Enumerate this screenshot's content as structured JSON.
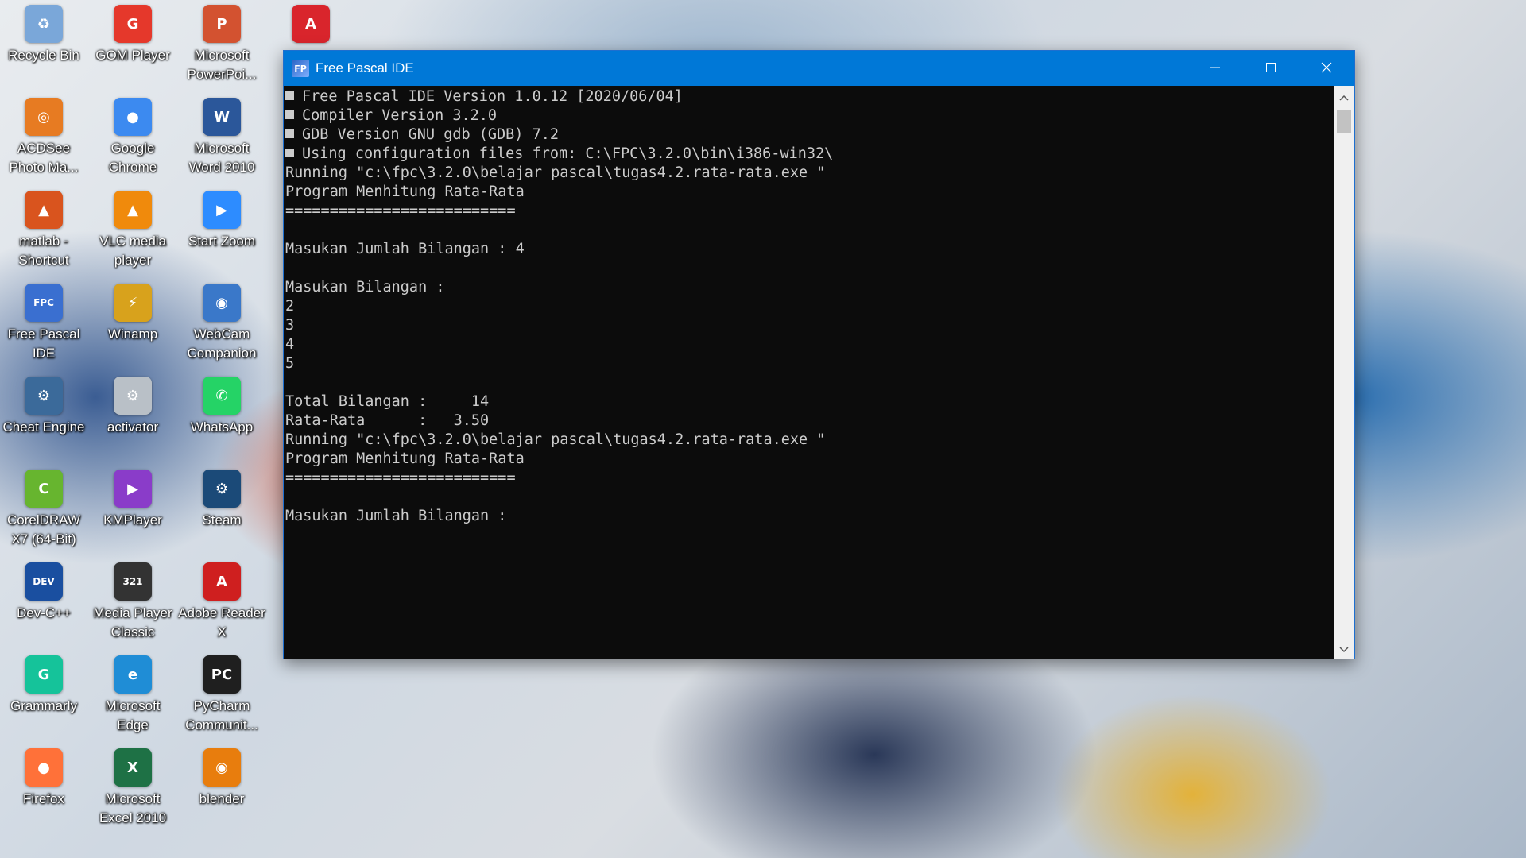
{
  "desktop": {
    "icons": [
      {
        "label": "Recycle Bin",
        "glyph": "♻",
        "color": "#7aa7d9"
      },
      {
        "label": "GOM Player",
        "glyph": "G",
        "color": "#e5382b"
      },
      {
        "label": "Microsoft PowerPoi...",
        "glyph": "P",
        "color": "#d35230"
      },
      {
        "label": "",
        "glyph": "A",
        "color": "#d9252c"
      },
      {
        "label": "ACDSee Photo Ma...",
        "glyph": "◎",
        "color": "#e77b22"
      },
      {
        "label": "Google Chrome",
        "glyph": "●",
        "color": "#3c8af0"
      },
      {
        "label": "Microsoft Word 2010",
        "glyph": "W",
        "color": "#2b579a"
      },
      {
        "label": "matlab - Shortcut",
        "glyph": "▲",
        "color": "#d9541e"
      },
      {
        "label": "VLC media player",
        "glyph": "▲",
        "color": "#f08a0c"
      },
      {
        "label": "Start Zoom",
        "glyph": "▶",
        "color": "#2d8cff"
      },
      {
        "label": "Free Pascal IDE",
        "glyph": "FPC",
        "color": "#3a6fd0"
      },
      {
        "label": "Winamp",
        "glyph": "⚡",
        "color": "#d8a21c"
      },
      {
        "label": "WebCam Companion",
        "glyph": "◉",
        "color": "#3a78c9"
      },
      {
        "label": "Cheat Engine",
        "glyph": "⚙",
        "color": "#3b6a9a"
      },
      {
        "label": "activator",
        "glyph": "⚙",
        "color": "#b9c0c7"
      },
      {
        "label": "WhatsApp",
        "glyph": "✆",
        "color": "#25d366"
      },
      {
        "label": "CorelDRAW X7 (64-Bit)",
        "glyph": "C",
        "color": "#67b52f"
      },
      {
        "label": "KMPlayer",
        "glyph": "▶",
        "color": "#8a3cc9"
      },
      {
        "label": "Steam",
        "glyph": "⚙",
        "color": "#1b4a78"
      },
      {
        "label": "Dev-C++",
        "glyph": "DEV",
        "color": "#1a4fa0"
      },
      {
        "label": "Media Player Classic",
        "glyph": "321",
        "color": "#333333"
      },
      {
        "label": "Adobe Reader X",
        "glyph": "A",
        "color": "#cf1f1f"
      },
      {
        "label": "Grammarly",
        "glyph": "G",
        "color": "#15c39a"
      },
      {
        "label": "Microsoft Edge",
        "glyph": "e",
        "color": "#1f8dd6"
      },
      {
        "label": "PyCharm Communit...",
        "glyph": "PC",
        "color": "#1f1f1f"
      },
      {
        "label": "Firefox",
        "glyph": "●",
        "color": "#ff7139"
      },
      {
        "label": "Microsoft Excel 2010",
        "glyph": "X",
        "color": "#1e7145"
      },
      {
        "label": "blender",
        "glyph": "◉",
        "color": "#e87d0d"
      }
    ]
  },
  "window": {
    "title": "Free Pascal IDE",
    "minimize_glyph": "—",
    "maximize_glyph": "☐",
    "close_glyph": "✕",
    "console_lines": [
      {
        "text": "Free Pascal IDE Version 1.0.12 [2020/06/04]",
        "bullet": true
      },
      {
        "text": "Compiler Version 3.2.0",
        "bullet": true
      },
      {
        "text": "GDB Version GNU gdb (GDB) 7.2",
        "bullet": true
      },
      {
        "text": "Using configuration files from: C:\\FPC\\3.2.0\\bin\\i386-win32\\",
        "bullet": true
      },
      {
        "text": "Running \"c:\\fpc\\3.2.0\\belajar pascal\\tugas4.2.rata-rata.exe \"",
        "bullet": false
      },
      {
        "text": "Program Menhitung Rata-Rata",
        "bullet": false
      },
      {
        "text": "==========================",
        "bullet": false
      },
      {
        "text": "",
        "bullet": false
      },
      {
        "text": "Masukan Jumlah Bilangan : 4",
        "bullet": false
      },
      {
        "text": "",
        "bullet": false
      },
      {
        "text": "Masukan Bilangan :",
        "bullet": false
      },
      {
        "text": "2",
        "bullet": false
      },
      {
        "text": "3",
        "bullet": false
      },
      {
        "text": "4",
        "bullet": false
      },
      {
        "text": "5",
        "bullet": false
      },
      {
        "text": "",
        "bullet": false
      },
      {
        "text": "Total Bilangan :     14",
        "bullet": false
      },
      {
        "text": "Rata-Rata      :   3.50",
        "bullet": false
      },
      {
        "text": "Running \"c:\\fpc\\3.2.0\\belajar pascal\\tugas4.2.rata-rata.exe \"",
        "bullet": false
      },
      {
        "text": "Program Menhitung Rata-Rata",
        "bullet": false
      },
      {
        "text": "==========================",
        "bullet": false
      },
      {
        "text": "",
        "bullet": false
      },
      {
        "text": "Masukan Jumlah Bilangan :",
        "bullet": false
      }
    ]
  },
  "colors": {
    "titlebar": "#0078d7",
    "console_bg": "#0c0c0c",
    "console_fg": "#cccccc"
  }
}
